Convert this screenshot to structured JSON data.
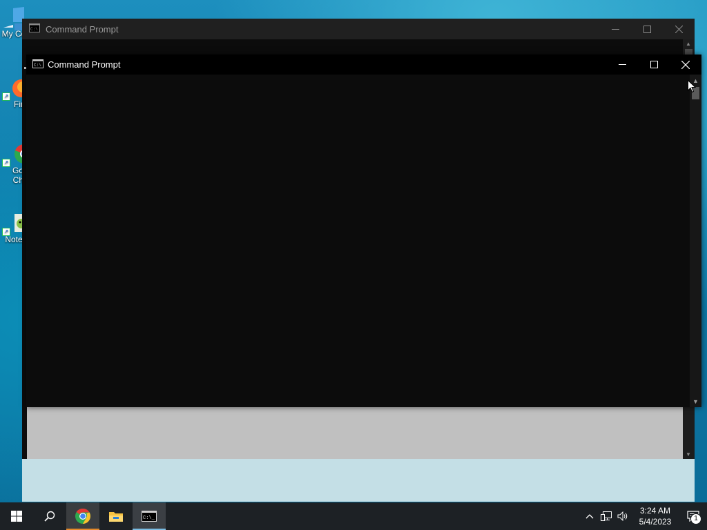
{
  "desktop": {
    "icons": [
      {
        "label": "My Co",
        "icon": "computer-icon"
      },
      {
        "label": "Fir",
        "icon": "firefox-icon"
      },
      {
        "label": "Go\nCh",
        "label_line1": "Go",
        "label_line2": "Ch",
        "icon": "chrome-icon"
      },
      {
        "label": "Note",
        "icon": "notepad-icon"
      }
    ]
  },
  "back_window": {
    "title": "Command Prompt",
    "title_color": "#9a9a9a"
  },
  "front_window": {
    "title": "Command Prompt",
    "console_bg": "#0c0c0c"
  },
  "taskbar": {
    "items": [
      {
        "name": "start",
        "icon": "windows-logo-icon"
      },
      {
        "name": "search",
        "icon": "search-icon"
      },
      {
        "name": "chrome",
        "icon": "chrome-icon"
      },
      {
        "name": "file-explorer",
        "icon": "folder-icon"
      },
      {
        "name": "command-prompt",
        "icon": "cmd-icon",
        "active": true
      }
    ],
    "tray": {
      "time": "3:24 AM",
      "date": "5/4/2023",
      "notification_count": "1"
    }
  },
  "colors": {
    "taskbar_bg": "#1d2125",
    "active_indicator": "#7bbde3",
    "chrome_indicator": "#e48a2b"
  }
}
